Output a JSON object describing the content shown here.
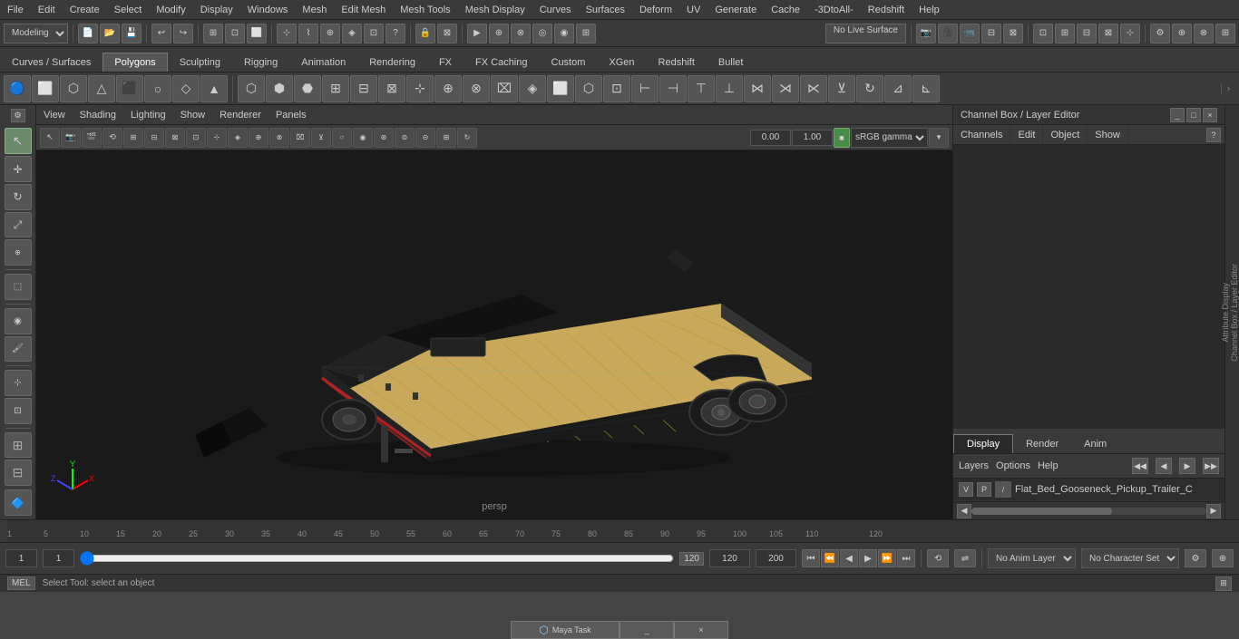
{
  "menubar": {
    "items": [
      "File",
      "Edit",
      "Create",
      "Select",
      "Modify",
      "Display",
      "Windows",
      "Mesh",
      "Edit Mesh",
      "Mesh Tools",
      "Mesh Display",
      "Curves",
      "Surfaces",
      "Deform",
      "UV",
      "Generate",
      "Cache",
      "-3DtoAll-",
      "Redshift",
      "Help"
    ]
  },
  "toolbar": {
    "mode_label": "Modeling",
    "live_surface": "No Live Surface",
    "gamma_value": "0.00",
    "gamma_scale": "1.00",
    "gamma_profile": "sRGB gamma"
  },
  "tabs": {
    "items": [
      "Curves / Surfaces",
      "Polygons",
      "Sculpting",
      "Rigging",
      "Animation",
      "Rendering",
      "FX",
      "FX Caching",
      "Custom",
      "XGen",
      "Redshift",
      "Bullet"
    ],
    "active": 1
  },
  "viewport": {
    "menus": [
      "View",
      "Shading",
      "Lighting",
      "Show",
      "Renderer",
      "Panels"
    ],
    "persp_label": "persp"
  },
  "right_panel": {
    "title": "Channel Box / Layer Editor",
    "tabs": [
      "Channels",
      "Edit",
      "Object",
      "Show"
    ],
    "display_tabs": [
      "Display",
      "Render",
      "Anim"
    ],
    "active_display_tab": 0,
    "sub_tabs": [
      "Layers",
      "Options",
      "Help"
    ],
    "layer_icons": [
      {
        "label": "◀",
        "title": "prev"
      },
      {
        "label": "◀",
        "title": "prev2"
      },
      {
        "label": "▶",
        "title": "next"
      },
      {
        "label": "▶",
        "title": "next2"
      }
    ],
    "layer_v_label": "V",
    "layer_p_label": "P",
    "layer_name": "Flat_Bed_Gooseneck_Pickup_Trailer_C"
  },
  "timeline": {
    "ticks": [
      "5",
      "10",
      "15",
      "20",
      "25",
      "30",
      "35",
      "40",
      "45",
      "50",
      "55",
      "60",
      "65",
      "70",
      "75",
      "80",
      "85",
      "90",
      "95",
      "100",
      "105",
      "110",
      "120"
    ]
  },
  "bottom_bar": {
    "frame_current": "1",
    "frame_start": "1",
    "frame_slider": "120",
    "frame_end": "120",
    "frame_max": "200",
    "layer_label": "No Anim Layer",
    "char_set_label": "No Character Set",
    "play_buttons": [
      "⏮",
      "⏪",
      "⏴",
      "⏵",
      "⏩",
      "⏭"
    ]
  },
  "status_bar": {
    "mel_label": "MEL",
    "status_text": "Select Tool: select an object"
  },
  "left_toolbar": {
    "tools": [
      {
        "icon": "↖",
        "name": "select-tool"
      },
      {
        "icon": "↔",
        "name": "move-tool"
      },
      {
        "icon": "↻",
        "name": "rotate-tool"
      },
      {
        "icon": "⤢",
        "name": "scale-tool"
      },
      {
        "icon": "⊕",
        "name": "multi-tool"
      },
      {
        "icon": "□",
        "name": "marquee-tool"
      },
      {
        "icon": "⬚",
        "name": "lasso-tool"
      },
      {
        "icon": "⬡",
        "name": "paint-tool"
      },
      {
        "icon": "+",
        "name": "snap-tool"
      },
      {
        "icon": "≡",
        "name": "layer-tool"
      },
      {
        "icon": "⊗",
        "name": "quick-tool"
      }
    ]
  }
}
